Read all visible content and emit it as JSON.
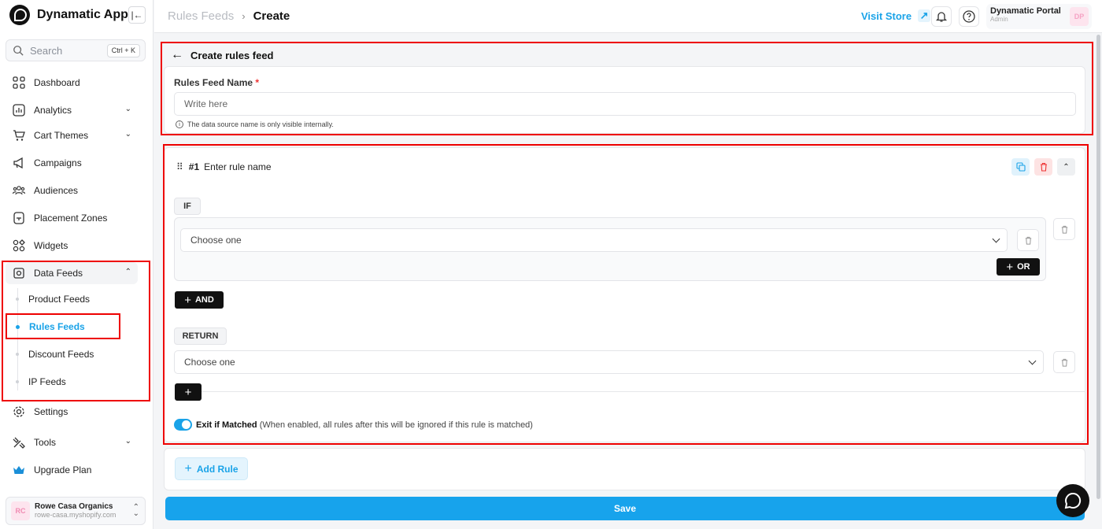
{
  "sidebar": {
    "app_name": "Dynamatic App",
    "search_placeholder": "Search",
    "search_shortcut": "Ctrl + K",
    "items": [
      {
        "label": "Dashboard"
      },
      {
        "label": "Analytics"
      },
      {
        "label": "Cart Themes"
      },
      {
        "label": "Campaigns"
      },
      {
        "label": "Audiences"
      },
      {
        "label": "Placement Zones"
      },
      {
        "label": "Widgets"
      },
      {
        "label": "Data Feeds"
      },
      {
        "label": "Settings"
      },
      {
        "label": "Tools"
      },
      {
        "label": "Upgrade Plan"
      }
    ],
    "data_feeds_sub": [
      {
        "label": "Product Feeds"
      },
      {
        "label": "Rules Feeds"
      },
      {
        "label": "Discount Feeds"
      },
      {
        "label": "IP Feeds"
      }
    ],
    "store": {
      "initials": "RC",
      "name": "Rowe Casa Organics",
      "domain": "rowe-casa.myshopify.com"
    }
  },
  "header": {
    "breadcrumb_parent": "Rules Feeds",
    "breadcrumb_current": "Create",
    "visit_store": "Visit Store",
    "portal_name": "Dynamatic Portal",
    "portal_role": "Admin",
    "portal_initials": "DP"
  },
  "form": {
    "title": "Create rules feed",
    "name_label": "Rules Feed Name",
    "name_required": "*",
    "name_placeholder": "Write here",
    "name_hint": "The data source name is only visible internally."
  },
  "rule": {
    "number": "#1",
    "name_placeholder": "Enter rule name",
    "if_label": "IF",
    "condition_select": "Choose one",
    "or_label": "OR",
    "and_label": "AND",
    "return_label": "RETURN",
    "return_select": "Choose one",
    "exit_label": "Exit if Matched",
    "exit_desc": "(When enabled, all rules after this will be ignored if this rule is matched)",
    "exit_enabled": true
  },
  "actions": {
    "add_rule": "Add Rule",
    "save": "Save"
  },
  "colors": {
    "accent": "#1aa3e8",
    "highlight_border": "#e00000"
  }
}
